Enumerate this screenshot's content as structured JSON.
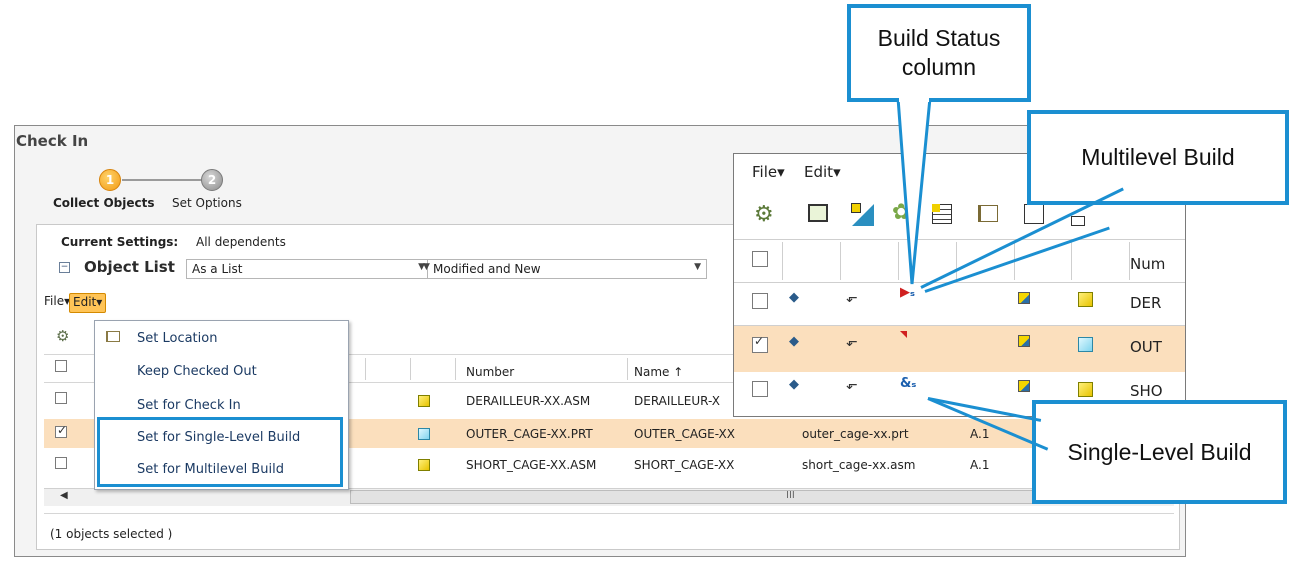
{
  "window": {
    "title": "Check In",
    "steps": [
      {
        "number": "1",
        "label": "Collect Objects"
      },
      {
        "number": "2",
        "label": "Set Options"
      }
    ],
    "current_settings_label": "Current Settings:",
    "current_settings_value": "All dependents",
    "object_list_label": "Object List",
    "view_select": "As a List",
    "filter_select": "Modified and New",
    "file_menu": "File",
    "edit_menu": "Edit",
    "edit_menu_items": [
      "Set Location",
      "Keep Checked Out",
      "Set for Check In",
      "Set for Single-Level Build",
      "Set for Multilevel Build"
    ],
    "columns": {
      "number": "Number",
      "name": "Name",
      "name_sort": "↑"
    },
    "rows": [
      {
        "number": "DERAILLEUR-XX.ASM",
        "name": "DERAILLEUR-X",
        "file": "",
        "version": "",
        "checked": false
      },
      {
        "number": "OUTER_CAGE-XX.PRT",
        "name": "OUTER_CAGE-XX",
        "file": "outer_cage-xx.prt",
        "version": "A.1",
        "checked": true
      },
      {
        "number": "SHORT_CAGE-XX.ASM",
        "name": "SHORT_CAGE-XX",
        "file": "short_cage-xx.asm",
        "version": "A.1",
        "checked": false
      }
    ],
    "scroll_mid": "III",
    "status": "(1 objects selected )"
  },
  "zoom": {
    "file_menu": "File",
    "edit_menu": "Edit",
    "column_header": "Num",
    "rows": [
      "DER",
      "OUT",
      "SHO"
    ]
  },
  "callouts": {
    "build_status": "Build Status column",
    "multilevel": "Multilevel Build",
    "single_level": "Single-Level Build"
  },
  "colors": {
    "accent": "#1b8fd1",
    "selected_row": "#fbdfbd",
    "edit_button": "#ffc457"
  }
}
